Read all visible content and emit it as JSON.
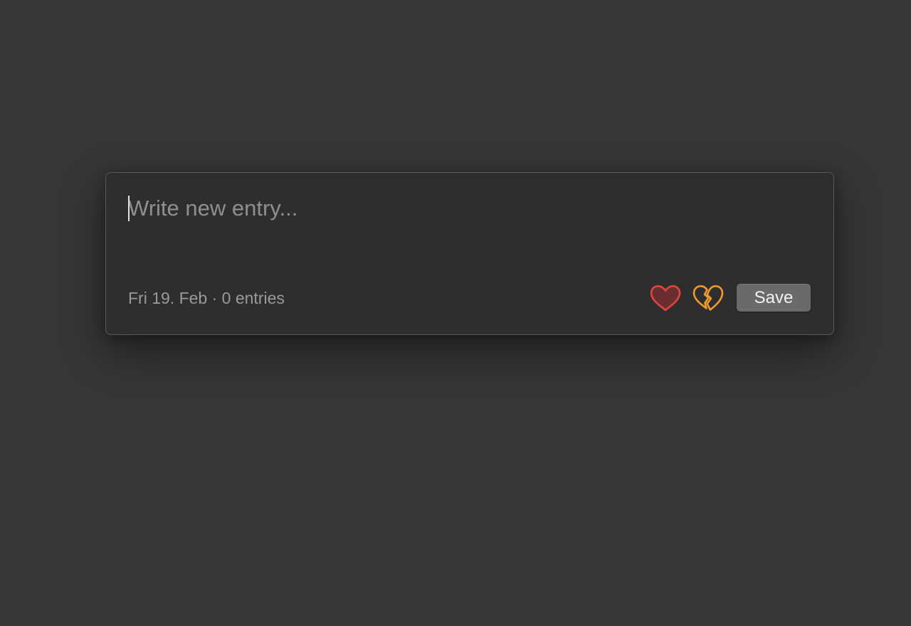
{
  "composer": {
    "placeholder": "Write new entry...",
    "value": "",
    "status": "Fri 19. Feb · 0 entries",
    "save_label": "Save",
    "love_icon": "heart-icon",
    "broken_icon": "broken-heart-icon"
  },
  "colors": {
    "background": "#363636",
    "panel": "#2e2e2e",
    "heart": "#e0453d",
    "broken_heart": "#f09a2b",
    "button": "#6a6a6a"
  }
}
